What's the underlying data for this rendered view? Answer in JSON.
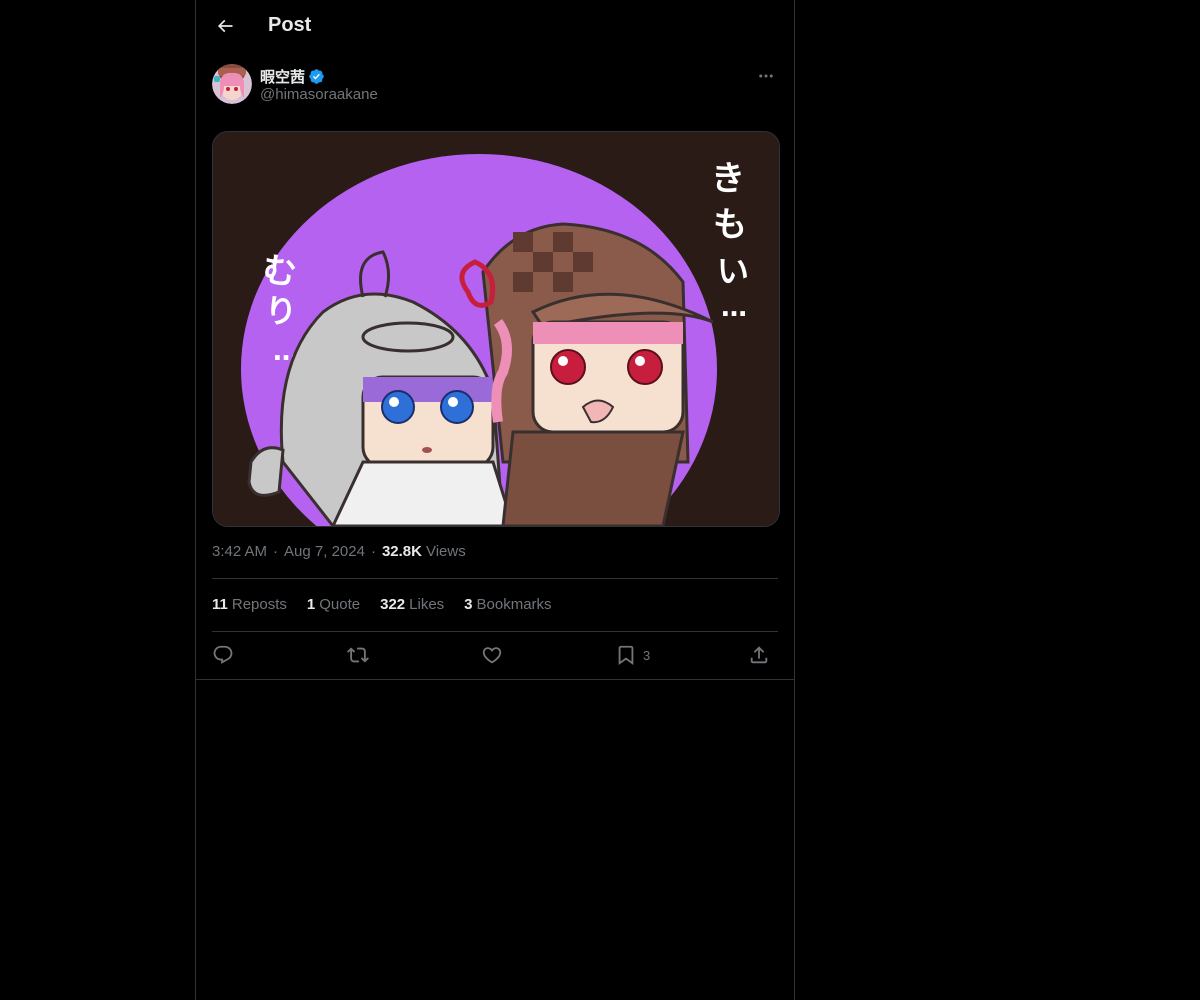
{
  "header": {
    "title": "Post",
    "back_icon": "arrow-left-icon"
  },
  "post": {
    "author": {
      "display_name": "暇空茜",
      "handle": "@himasoraakane",
      "verified": true,
      "verified_color": "#1d9bf0",
      "avatar_icon": "avatar-image"
    },
    "media": {
      "description_icon": "media-image",
      "text_left": "むり…",
      "text_right": "きもい…",
      "circle_color": "#b562f0"
    },
    "time": "3:42 AM",
    "date": "Aug 7, 2024",
    "separator": "·",
    "views_count": "32.8K",
    "views_label": "Views",
    "stats": {
      "reposts_count": "11",
      "reposts_label": "Reposts",
      "quotes_count": "1",
      "quotes_label": "Quote",
      "likes_count": "322",
      "likes_label": "Likes",
      "bookmarks_count": "3",
      "bookmarks_label": "Bookmarks"
    },
    "actions": {
      "reply_icon": "reply-icon",
      "repost_icon": "repost-icon",
      "like_icon": "heart-icon",
      "bookmark_icon": "bookmark-icon",
      "bookmark_count": "3",
      "share_icon": "share-icon"
    }
  },
  "colors": {
    "background": "#000000",
    "border": "#2f3336",
    "text_primary": "#e7e9ea",
    "text_secondary": "#71767b",
    "accent": "#1d9bf0"
  }
}
